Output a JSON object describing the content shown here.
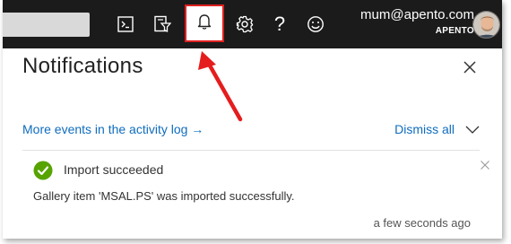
{
  "topbar": {
    "icons": [
      "cloud-shell-icon",
      "directory-filter-icon",
      "bell-icon",
      "gear-icon",
      "question-icon",
      "smiley-icon"
    ],
    "help_glyph": "?",
    "account": {
      "email": "mum@apento.com",
      "org": "APENTO"
    }
  },
  "panel": {
    "title": "Notifications",
    "activity_link": "More events in the activity log →",
    "dismiss_all": "Dismiss all"
  },
  "notification": {
    "status": "success",
    "title": "Import succeeded",
    "body": "Gallery item 'MSAL.PS' was imported successfully.",
    "time": "a few seconds ago"
  },
  "colors": {
    "topbar": "#1b1b1b",
    "link": "#0f6cbd",
    "success": "#57a300",
    "highlight": "#e02020"
  }
}
